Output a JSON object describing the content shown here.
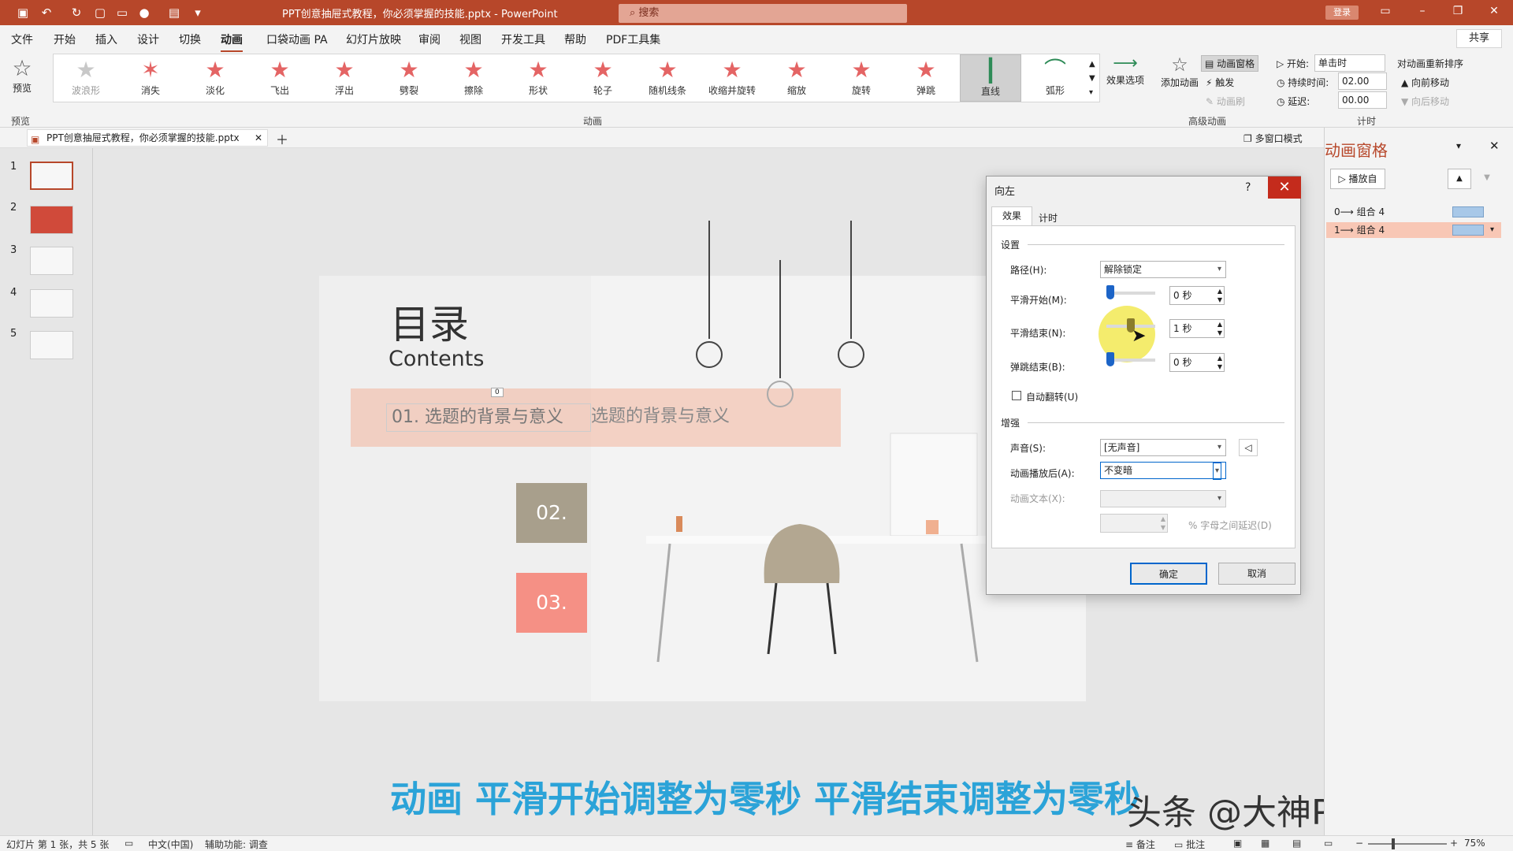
{
  "title_bar": {
    "doc_title": "PPT创意抽屉式教程，你必须掌握的技能.pptx - PowerPoint",
    "search": "搜索",
    "login": "登录"
  },
  "menu": {
    "tabs": [
      "文件",
      "开始",
      "插入",
      "设计",
      "切换",
      "动画",
      "口袋动画 PA",
      "幻灯片放映",
      "审阅",
      "视图",
      "开发工具",
      "帮助",
      "PDF工具集"
    ],
    "share": "共享"
  },
  "ribbon": {
    "preview": "预览",
    "preview_group": "预览",
    "anim_group": "动画",
    "adv_group": "高级动画",
    "timing_group": "计时",
    "effects": [
      "波浪形",
      "消失",
      "淡化",
      "飞出",
      "浮出",
      "劈裂",
      "擦除",
      "形状",
      "轮子",
      "随机线条",
      "收缩并旋转",
      "缩放",
      "旋转",
      "弹跳",
      "直线",
      "弧形"
    ],
    "effect_options": "效果选项",
    "add_anim": "添加动画",
    "anim_pane": "动画窗格",
    "trigger": "触发",
    "anim_brush": "动画刷",
    "start_label": "开始:",
    "start_value": "单击时",
    "duration_label": "持续时间:",
    "duration_value": "02.00",
    "delay_label": "延迟:",
    "delay_value": "00.00",
    "reorder": "对动画重新排序",
    "move_earlier": "向前移动",
    "move_later": "向后移动"
  },
  "doc_tab": {
    "name": "PPT创意抽屉式教程，你必须掌握的技能.pptx",
    "multi_window": "多窗口模式"
  },
  "thumbnails": [
    "1",
    "2",
    "3",
    "4",
    "5"
  ],
  "slide": {
    "title": "目录",
    "subtitle": "Contents",
    "item1": "01.  选题的背景与意义",
    "item1_ghost": "选题的背景与意义",
    "item2": "02.",
    "item3": "03.",
    "tag0": "0"
  },
  "dialog": {
    "title": "向左",
    "help": "?",
    "tab_effect": "效果",
    "tab_timing": "计时",
    "section_settings": "设置",
    "path_label": "路径(H):",
    "path_value": "解除锁定",
    "smooth_start_label": "平滑开始(M):",
    "smooth_start_value": "0 秒",
    "smooth_end_label": "平滑结束(N):",
    "smooth_end_value": "1 秒",
    "bounce_end_label": "弹跳结束(B):",
    "bounce_end_value": "0 秒",
    "auto_reverse": "自动翻转(U)",
    "section_enhance": "增强",
    "sound_label": "声音(S):",
    "sound_value": "[无声音]",
    "after_label": "动画播放后(A):",
    "after_value": "不变暗",
    "text_label": "动画文本(X):",
    "percent_label": "% 字母之间延迟(D)",
    "ok": "确定",
    "cancel": "取消"
  },
  "anim_pane": {
    "title": "动画窗格",
    "play_from": "播放自",
    "items": [
      "0⟶ 组合 4",
      "1⟶ 组合 4"
    ]
  },
  "caption": "动画 平滑开始调整为零秒 平滑结束调整为零秒",
  "watermark": "头条 @大神PPT课堂",
  "status": {
    "slide_info": "幻灯片 第 1 张，共 5 张",
    "lang": "中文(中国)",
    "access": "辅助功能: 调查",
    "notes": "备注",
    "comments": "批注",
    "zoom": "75%"
  }
}
